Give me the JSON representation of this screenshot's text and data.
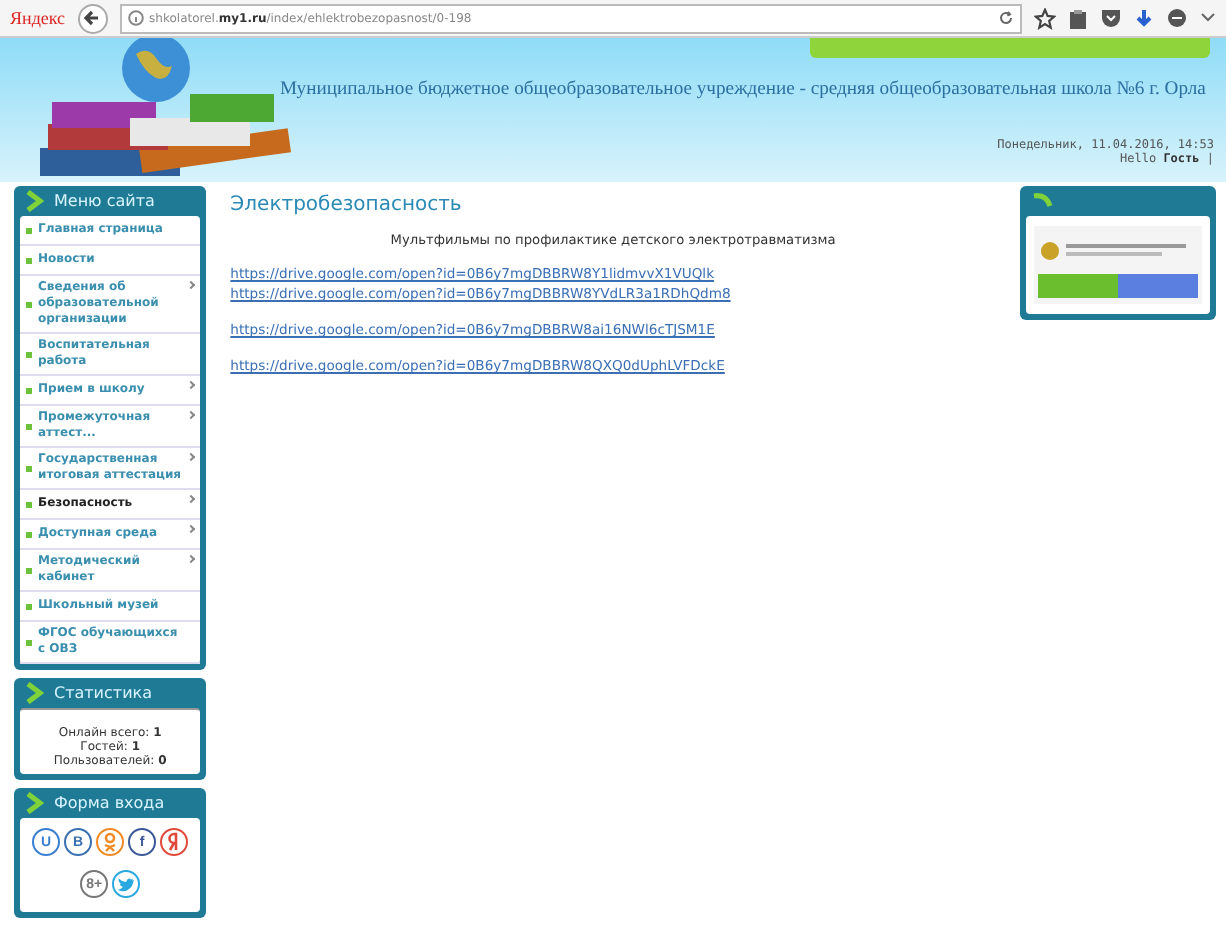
{
  "browser": {
    "brand": "Яндекс",
    "url_pre": "shkolatorel.",
    "url_bold": "my1.ru",
    "url_post": "/index/ehlektrobezopasnost/0-198"
  },
  "header": {
    "title": "Муниципальное бюджетное общеобразовательное учреждение - средняя общеобразовательная школа №6 г. Орла",
    "date": "Понедельник, 11.04.2016, 14:53",
    "hello": "Hello",
    "user": "Гость",
    "sep": "|"
  },
  "menu": {
    "title": "Меню сайта",
    "items": [
      {
        "label": "Главная страница",
        "submenu": false,
        "selected": false
      },
      {
        "label": "Новости",
        "submenu": false,
        "selected": false
      },
      {
        "label": "Сведения об образовательной организации",
        "submenu": true,
        "selected": false
      },
      {
        "label": "Воспитательная работа",
        "submenu": false,
        "selected": false
      },
      {
        "label": "Прием в школу",
        "submenu": true,
        "selected": false
      },
      {
        "label": "Промежуточная аттест...",
        "submenu": true,
        "selected": false
      },
      {
        "label": "Государственная итоговая аттестация",
        "submenu": true,
        "selected": false
      },
      {
        "label": "Безопасность",
        "submenu": true,
        "selected": true
      },
      {
        "label": "Доступная среда",
        "submenu": true,
        "selected": false
      },
      {
        "label": "Методический кабинет",
        "submenu": true,
        "selected": false
      },
      {
        "label": "Школьный музей",
        "submenu": false,
        "selected": false
      },
      {
        "label": "ФГОС обучающихся с ОВЗ",
        "submenu": false,
        "selected": false
      }
    ]
  },
  "stats": {
    "title": "Статистика",
    "rows": [
      {
        "label": "Онлайн всего:",
        "value": "1"
      },
      {
        "label": "Гостей:",
        "value": "1"
      },
      {
        "label": "Пользователей:",
        "value": "0"
      }
    ]
  },
  "login": {
    "title": "Форма входа",
    "socials": [
      {
        "kind": "letter",
        "label": "U",
        "color": "#3a7fd0"
      },
      {
        "kind": "letter",
        "label": "B",
        "color": "#3a6fb0"
      },
      {
        "kind": "ok",
        "color": "#f08a24"
      },
      {
        "kind": "letter",
        "label": "f",
        "color": "#3b5998"
      },
      {
        "kind": "ya",
        "color": "#e04a3a"
      },
      {
        "kind": "letter",
        "label": "8+",
        "color": "#777777"
      },
      {
        "kind": "twitter",
        "color": "#2aa9e0"
      }
    ]
  },
  "content": {
    "title": "Электробезопасность",
    "subtitle": "Мультфильмы по профилактике детского электротравматизма",
    "link_groups": [
      [
        "https://drive.google.com/open?id=0B6y7mgDBBRW8Y1lidmvvX1VUQlk",
        "https://drive.google.com/open?id=0B6y7mgDBBRW8YVdLR3a1RDhQdm8"
      ],
      [
        "https://drive.google.com/open?id=0B6y7mgDBBRW8ai16NWl6cTJSM1E"
      ],
      [
        "https://drive.google.com/open?id=0B6y7mgDBBRW8QXQ0dUphLVFDckE"
      ]
    ]
  }
}
